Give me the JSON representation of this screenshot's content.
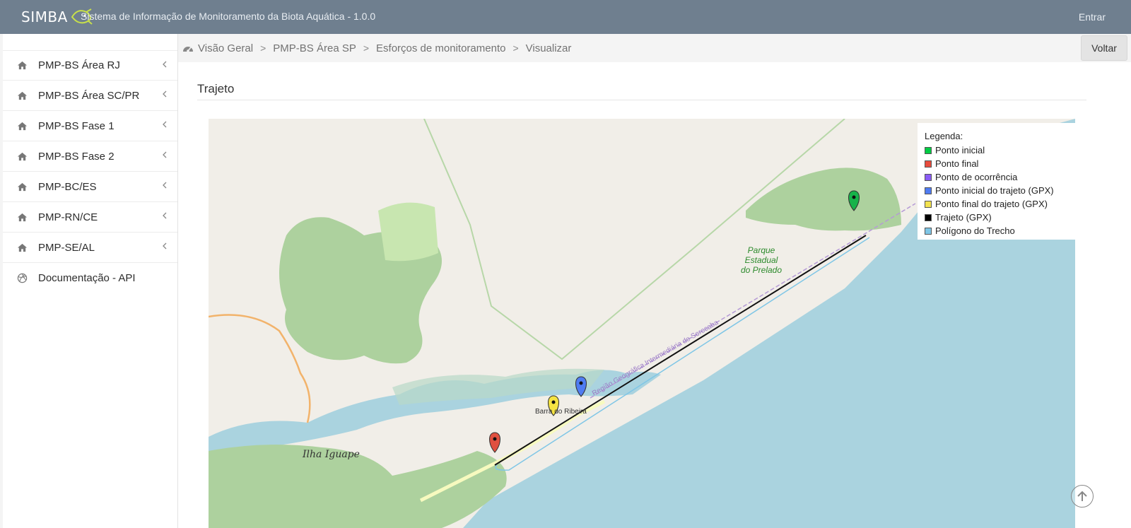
{
  "header": {
    "brand": "SIMBA",
    "app_title": "Sistema de Informação de Monitoramento da Biota Aquática - 1.0.0",
    "login_label": "Entrar"
  },
  "sidebar": {
    "items": [
      {
        "label": "PMP-BS Área RJ",
        "icon": "home-icon",
        "expandable": true
      },
      {
        "label": "PMP-BS Área SC/PR",
        "icon": "home-icon",
        "expandable": true
      },
      {
        "label": "PMP-BS Fase 1",
        "icon": "home-icon",
        "expandable": true
      },
      {
        "label": "PMP-BS Fase 2",
        "icon": "home-icon",
        "expandable": true
      },
      {
        "label": "PMP-BC/ES",
        "icon": "home-icon",
        "expandable": true
      },
      {
        "label": "PMP-RN/CE",
        "icon": "home-icon",
        "expandable": true
      },
      {
        "label": "PMP-SE/AL",
        "icon": "home-icon",
        "expandable": true
      },
      {
        "label": "Documentação - API",
        "icon": "basketball-icon",
        "expandable": false
      }
    ]
  },
  "breadcrumb": {
    "items": [
      "Visão Geral",
      "PMP-BS Área SP",
      "Esforços de monitoramento",
      "Visualizar"
    ],
    "separator": ">"
  },
  "toolbar": {
    "back_label": "Voltar"
  },
  "section": {
    "title": "Trajeto"
  },
  "map": {
    "labels": {
      "park": [
        "Parque",
        "Estadual",
        "do Prelado"
      ],
      "island": "Ilha Iguape",
      "town": "Barra do Ribeira",
      "road": "Região Geográfica Intermediária de Sorocaba"
    },
    "legend": {
      "title": "Legenda:",
      "items": [
        {
          "label": "Ponto inicial",
          "color": "#00cc44"
        },
        {
          "label": "Ponto final",
          "color": "#e84c3d"
        },
        {
          "label": "Ponto de ocorrência",
          "color": "#8a5cf6"
        },
        {
          "label": "Ponto inicial do trajeto (GPX)",
          "color": "#4f7cf2"
        },
        {
          "label": "Ponto final do trajeto (GPX)",
          "color": "#f2e24f"
        },
        {
          "label": "Trajeto (GPX)",
          "color": "#000000"
        },
        {
          "label": "Polígono do Trecho",
          "color": "#7fc6e6"
        }
      ]
    },
    "markers": [
      {
        "name": "ponto-inicial",
        "color": "#17b34a"
      },
      {
        "name": "ponto-final",
        "color": "#e05040"
      },
      {
        "name": "ponto-inicial-gpx",
        "color": "#4f7cf2"
      },
      {
        "name": "ponto-final-gpx",
        "color": "#f5e342"
      }
    ],
    "colors": {
      "sea": "#aad3df",
      "land": "#f1eee8",
      "forest": "#add19e",
      "water": "#aad3df",
      "road": "#f7fabf"
    }
  }
}
